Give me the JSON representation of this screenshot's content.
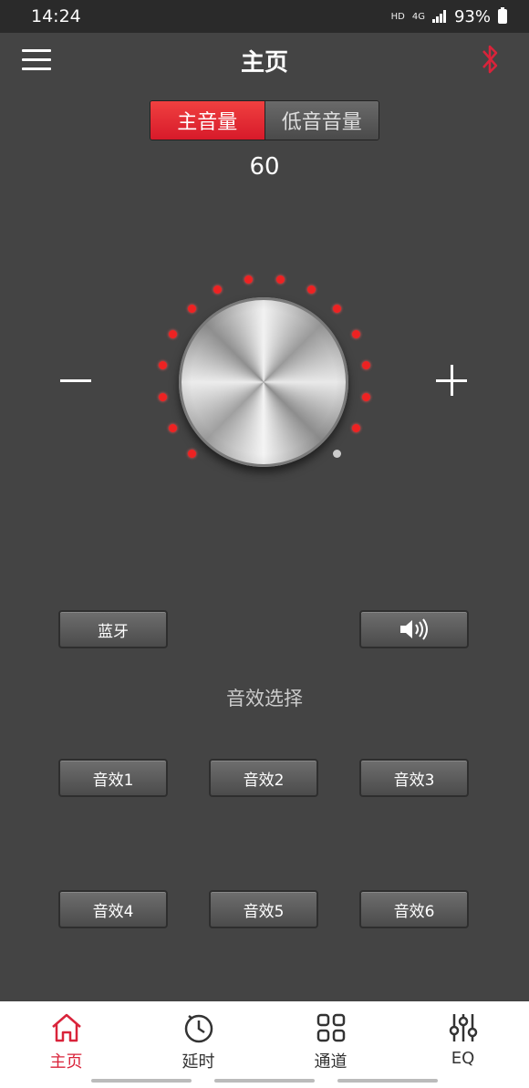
{
  "status_bar": {
    "time": "14:24",
    "network_hd": "HD",
    "network_4g": "4G",
    "battery": "93%"
  },
  "header": {
    "title": "主页"
  },
  "volume": {
    "tabs": [
      {
        "label": "主音量",
        "active": true
      },
      {
        "label": "低音音量",
        "active": false
      }
    ],
    "value": "60",
    "level_fraction": 0.93
  },
  "controls": {
    "bluetooth_label": "蓝牙",
    "speaker_icon": "speaker-icon"
  },
  "effects": {
    "section_label": "音效选择",
    "buttons": [
      "音效1",
      "音效2",
      "音效3",
      "音效4",
      "音效5",
      "音效6"
    ]
  },
  "bottom_nav": [
    {
      "label": "主页",
      "icon": "home-icon",
      "active": true
    },
    {
      "label": "延时",
      "icon": "clock-icon",
      "active": false
    },
    {
      "label": "通道",
      "icon": "grid-icon",
      "active": false
    },
    {
      "label": "EQ",
      "icon": "equalizer-icon",
      "active": false
    }
  ],
  "colors": {
    "accent": "#d9233a",
    "background": "#444444"
  }
}
